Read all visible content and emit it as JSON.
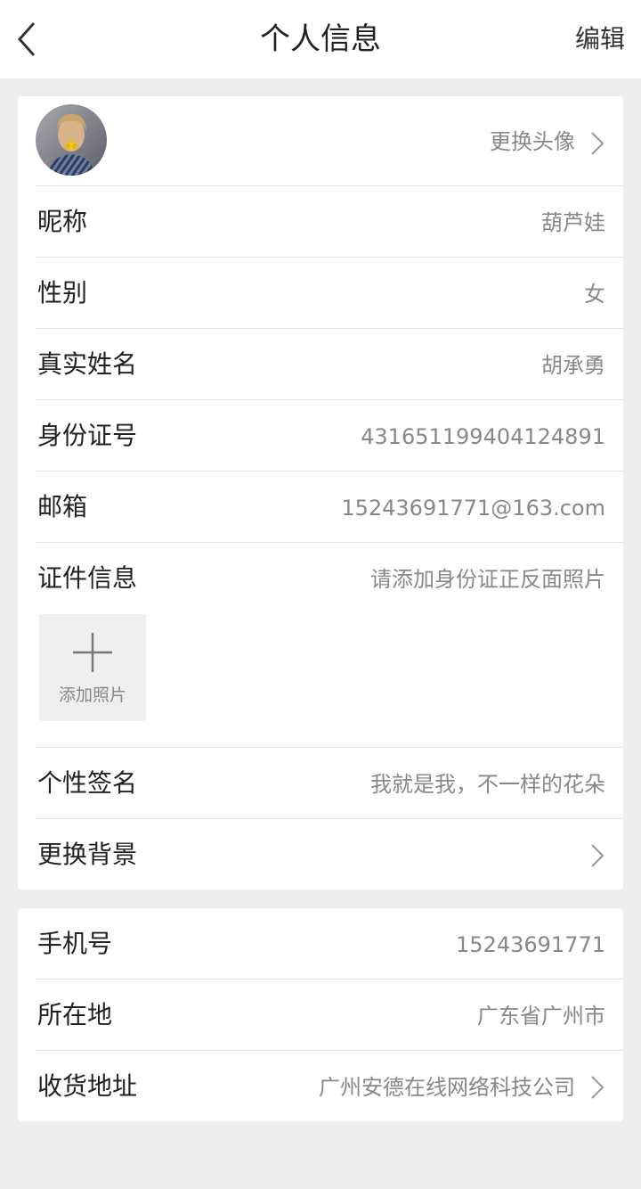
{
  "header": {
    "title": "个人信息",
    "edit_label": "编辑"
  },
  "profile": {
    "avatar_action": "更换头像",
    "nickname_label": "昵称",
    "nickname_value": "葫芦娃",
    "gender_label": "性别",
    "gender_value": "女",
    "realname_label": "真实姓名",
    "realname_value": "胡承勇",
    "idnum_label": "身份证号",
    "idnum_value": "431651199404124891",
    "email_label": "邮箱",
    "email_value": "15243691771@163.com",
    "cert_label": "证件信息",
    "cert_hint": "请添加身份证正反面照片",
    "add_photo_label": "添加照片",
    "signature_label": "个性签名",
    "signature_value": "我就是我，不一样的花朵",
    "background_label": "更换背景"
  },
  "contact": {
    "phone_label": "手机号",
    "phone_value": "15243691771",
    "location_label": "所在地",
    "location_value": "广东省广州市",
    "address_label": "收货地址",
    "address_value": "广州安德在线网络科技公司"
  },
  "colors": {
    "background": "#eeeeee",
    "card": "#ffffff",
    "label": "#222222",
    "value": "#888888",
    "divider": "#e3e3e3"
  },
  "icons": {
    "back": "chevron-left-icon",
    "chevron": "chevron-right-icon",
    "add": "plus-icon"
  }
}
